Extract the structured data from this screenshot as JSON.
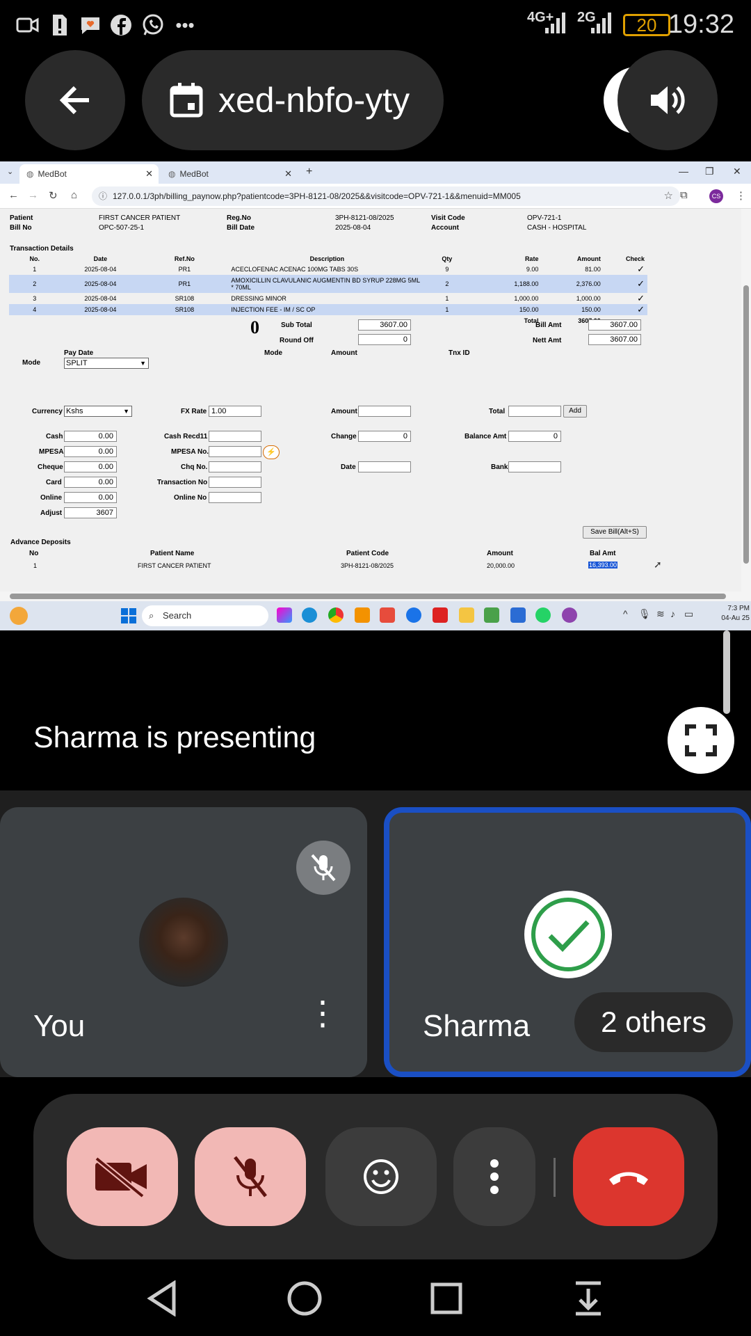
{
  "status_bar": {
    "time": "19:32",
    "battery": "20",
    "network1": "4G+",
    "network2": "2G",
    "icons": [
      "video-camera-icon",
      "sim-alert-icon",
      "chat-heart-icon",
      "facebook-icon",
      "whatsapp-icon",
      "more-dots-icon"
    ]
  },
  "meeting": {
    "code": "xed-nbfo-yty",
    "presenting_text": "Sharma is presenting"
  },
  "browser": {
    "tabs": [
      {
        "label": "MedBot"
      },
      {
        "label": "MedBot"
      }
    ],
    "url": "127.0.0.1/3ph/billing_paynow.php?patientcode=3PH-8121-08/2025&&visitcode=OPV-721-1&&menuid=MM005",
    "profile": "CS"
  },
  "billing": {
    "header": {
      "patient_label": "Patient",
      "patient": "FIRST CANCER PATIENT",
      "regno_label": "Reg.No",
      "regno": "3PH-8121-08/2025",
      "visitcode_label": "Visit Code",
      "visitcode": "OPV-721-1",
      "billno_label": "Bill No",
      "billno": "OPC-507-25-1",
      "billdate_label": "Bill Date",
      "billdate": "2025-08-04",
      "account_label": "Account",
      "account": "CASH - HOSPITAL"
    },
    "transactions_title": "Transaction Details",
    "columns": [
      "No.",
      "Date",
      "Ref.No",
      "Description",
      "Qty",
      "Rate",
      "Amount",
      "Check"
    ],
    "rows": [
      {
        "no": "1",
        "date": "2025-08-04",
        "ref": "PR1",
        "desc": "ACECLOFENAC ACENAC 100MG TABS 30S",
        "qty": "9",
        "rate": "9.00",
        "amount": "81.00"
      },
      {
        "no": "2",
        "date": "2025-08-04",
        "ref": "PR1",
        "desc": "AMOXICILLIN CLAVULANIC AUGMENTIN BD SYRUP 228MG 5ML * 70ML",
        "qty": "2",
        "rate": "1,188.00",
        "amount": "2,376.00"
      },
      {
        "no": "3",
        "date": "2025-08-04",
        "ref": "SR108",
        "desc": "DRESSING MINOR",
        "qty": "1",
        "rate": "1,000.00",
        "amount": "1,000.00"
      },
      {
        "no": "4",
        "date": "2025-08-04",
        "ref": "SR108",
        "desc": "INJECTION FEE - IM / SC OP",
        "qty": "1",
        "rate": "150.00",
        "amount": "150.00"
      }
    ],
    "check_mark": "✓",
    "total_label": "Total",
    "total": "3607.00",
    "big_zero": "0",
    "subtotal_label": "Sub Total",
    "subtotal": "3607.00",
    "roundoff_label": "Round Off",
    "roundoff": "0",
    "billamt_label": "Bill Amt",
    "billamt": "3607.00",
    "nettamt_label": "Nett Amt",
    "nettamt": "3607.00",
    "paydate_label": "Pay Date",
    "mode_label": "Mode",
    "mode_value": "SPLIT",
    "mode_col": "Mode",
    "amount_col": "Amount",
    "tnxid_col": "Tnx ID",
    "currency_label": "Currency",
    "currency": "Kshs",
    "fxrate_label": "FX Rate",
    "fxrate": "1.00",
    "amount_label": "Amount",
    "amount_val": "",
    "total2_label": "Total",
    "total2_val": "",
    "add_label": "Add",
    "cash_label": "Cash",
    "cash": "0.00",
    "cashrecd_label": "Cash Recd11",
    "cashrecd": "",
    "change_label": "Change",
    "change": "0",
    "balance_label": "Balance Amt",
    "balance": "0",
    "mpesa_label": "MPESA",
    "mpesa": "0.00",
    "mpesano_label": "MPESA No.",
    "mpesano": "",
    "cheque_label": "Cheque",
    "cheque": "0.00",
    "chqno_label": "Chq No.",
    "chqno": "",
    "date_label": "Date",
    "date_val": "",
    "bank_label": "Bank",
    "bank_val": "",
    "card_label": "Card",
    "card": "0.00",
    "txnno_label": "Transaction No",
    "txnno": "",
    "online_label": "Online",
    "online": "0.00",
    "onlineno_label": "Online No",
    "onlineno": "",
    "adjust_label": "Adjust",
    "adjust": "3607",
    "save_label": "Save Bill(Alt+S)",
    "advance_title": "Advance Deposits",
    "adv_columns": [
      "No",
      "Patient Name",
      "Patient Code",
      "Amount",
      "Bal Amt"
    ],
    "adv_rows": [
      {
        "no": "1",
        "name": "FIRST CANCER PATIENT",
        "code": "3PH-8121-08/2025",
        "amount": "20,000.00",
        "bal": "16,393.00"
      }
    ]
  },
  "taskbar": {
    "search_placeholder": "Search",
    "clock_time": "7:3 PM",
    "clock_date": "04-Au 25"
  },
  "participants": {
    "you": "You",
    "sharma": "Sharma",
    "others": "2 others"
  }
}
